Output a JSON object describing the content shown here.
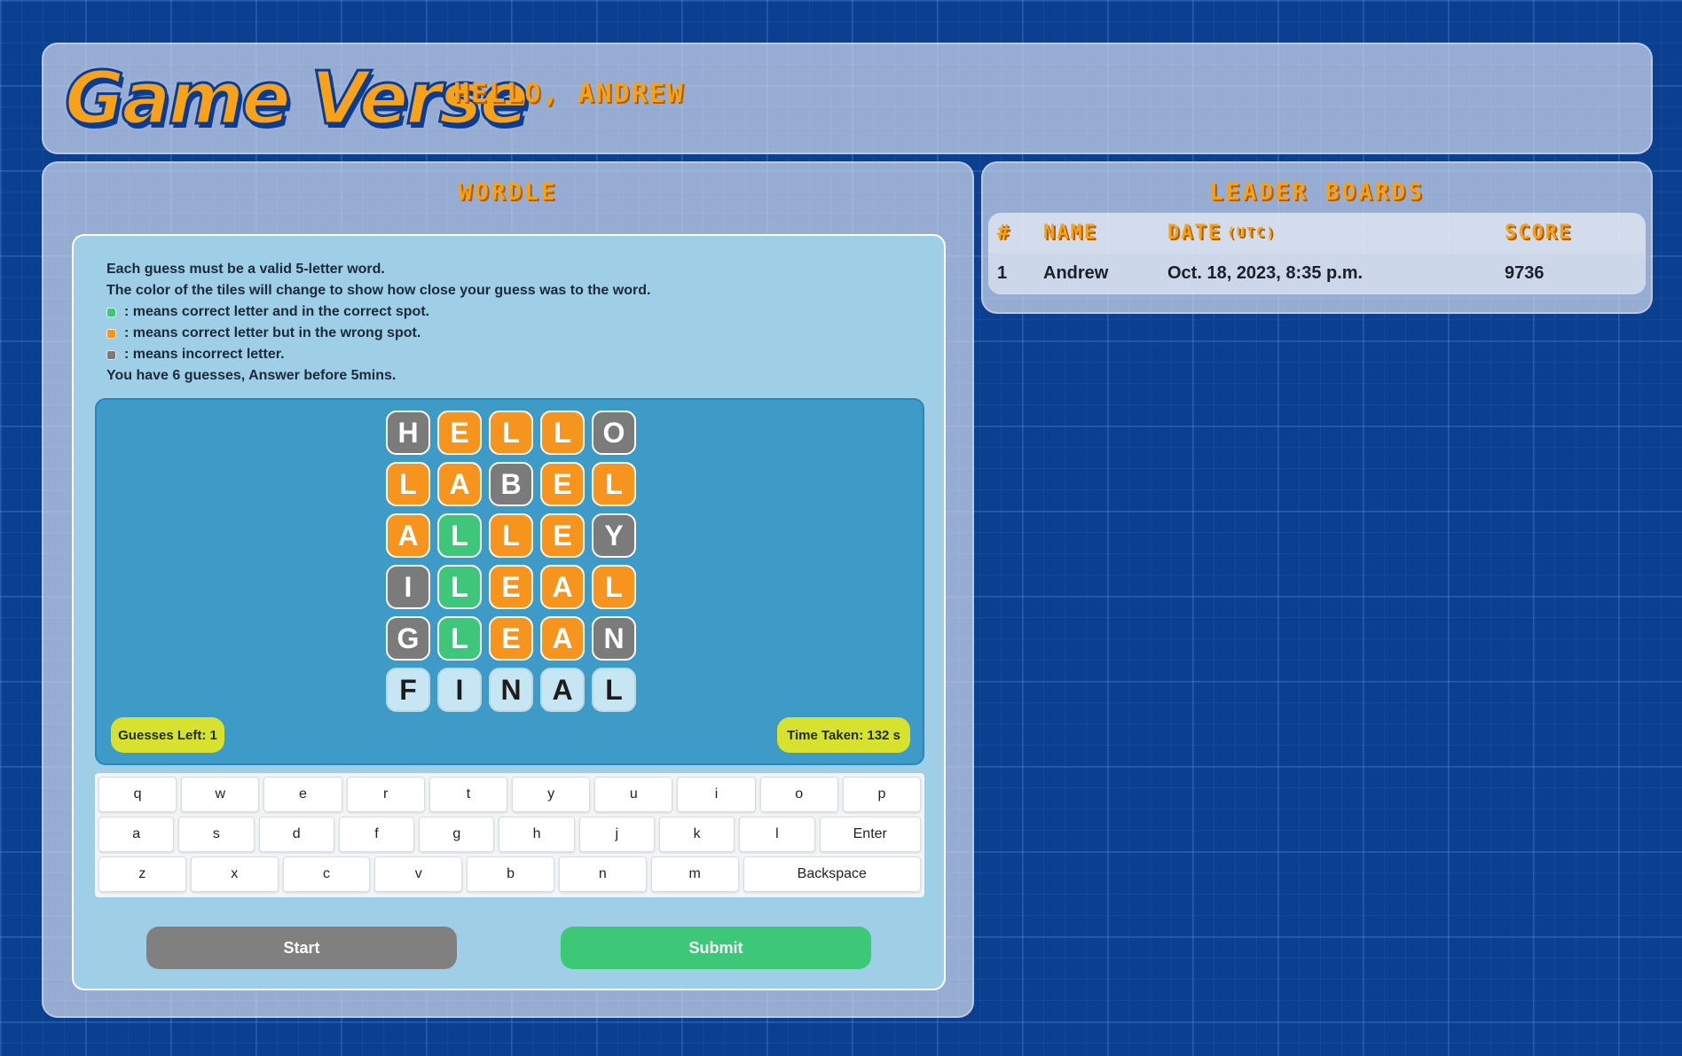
{
  "header": {
    "logo_text": "Game Verse",
    "greeting": "HELLO, ANDREW"
  },
  "game": {
    "title": "WORDLE",
    "rules": {
      "line1": "Each guess must be a valid 5-letter word.",
      "line2": "The color of the tiles will change to show how close your guess was to the word.",
      "legend_correct": ": means correct letter and in the correct spot.",
      "legend_present": ": means correct letter but in the wrong spot.",
      "legend_absent": ": means incorrect letter.",
      "line_last": "You have 6 guesses, Answer before 5mins."
    },
    "colors": {
      "correct": "#3ec77a",
      "present": "#f7941d",
      "absent": "#7b7b7b",
      "empty": "#c6e6f3"
    },
    "guesses": [
      {
        "letters": [
          "H",
          "E",
          "L",
          "L",
          "O"
        ],
        "states": [
          "absent",
          "present",
          "present",
          "present",
          "absent"
        ]
      },
      {
        "letters": [
          "L",
          "A",
          "B",
          "E",
          "L"
        ],
        "states": [
          "present",
          "present",
          "absent",
          "present",
          "present"
        ]
      },
      {
        "letters": [
          "A",
          "L",
          "L",
          "E",
          "Y"
        ],
        "states": [
          "present",
          "correct",
          "present",
          "present",
          "absent"
        ]
      },
      {
        "letters": [
          "I",
          "L",
          "E",
          "A",
          "L"
        ],
        "states": [
          "absent",
          "correct",
          "present",
          "present",
          "present"
        ]
      },
      {
        "letters": [
          "G",
          "L",
          "E",
          "A",
          "N"
        ],
        "states": [
          "absent",
          "correct",
          "present",
          "present",
          "absent"
        ]
      },
      {
        "letters": [
          "F",
          "I",
          "N",
          "A",
          "L"
        ],
        "states": [
          "empty",
          "empty",
          "empty",
          "empty",
          "empty"
        ]
      }
    ],
    "guesses_left": "Guesses Left: 1",
    "time_taken": "Time Taken: 132 s",
    "keyboard": {
      "row1": [
        "q",
        "w",
        "e",
        "r",
        "t",
        "y",
        "u",
        "i",
        "o",
        "p"
      ],
      "row2": [
        "a",
        "s",
        "d",
        "f",
        "g",
        "h",
        "j",
        "k",
        "l",
        "Enter"
      ],
      "row3": [
        "z",
        "x",
        "c",
        "v",
        "b",
        "n",
        "m",
        "Backspace"
      ]
    },
    "start_label": "Start",
    "submit_label": "Submit"
  },
  "leaderboard": {
    "title": "LEADER BOARDS",
    "headers": {
      "rank": "#",
      "name": "NAME",
      "date": "DATE",
      "date_suffix": "(UTC)",
      "score": "SCORE"
    },
    "rows": [
      {
        "rank": "1",
        "name": "Andrew",
        "date": "Oct. 18, 2023, 8:35 p.m.",
        "score": "9736"
      }
    ]
  }
}
